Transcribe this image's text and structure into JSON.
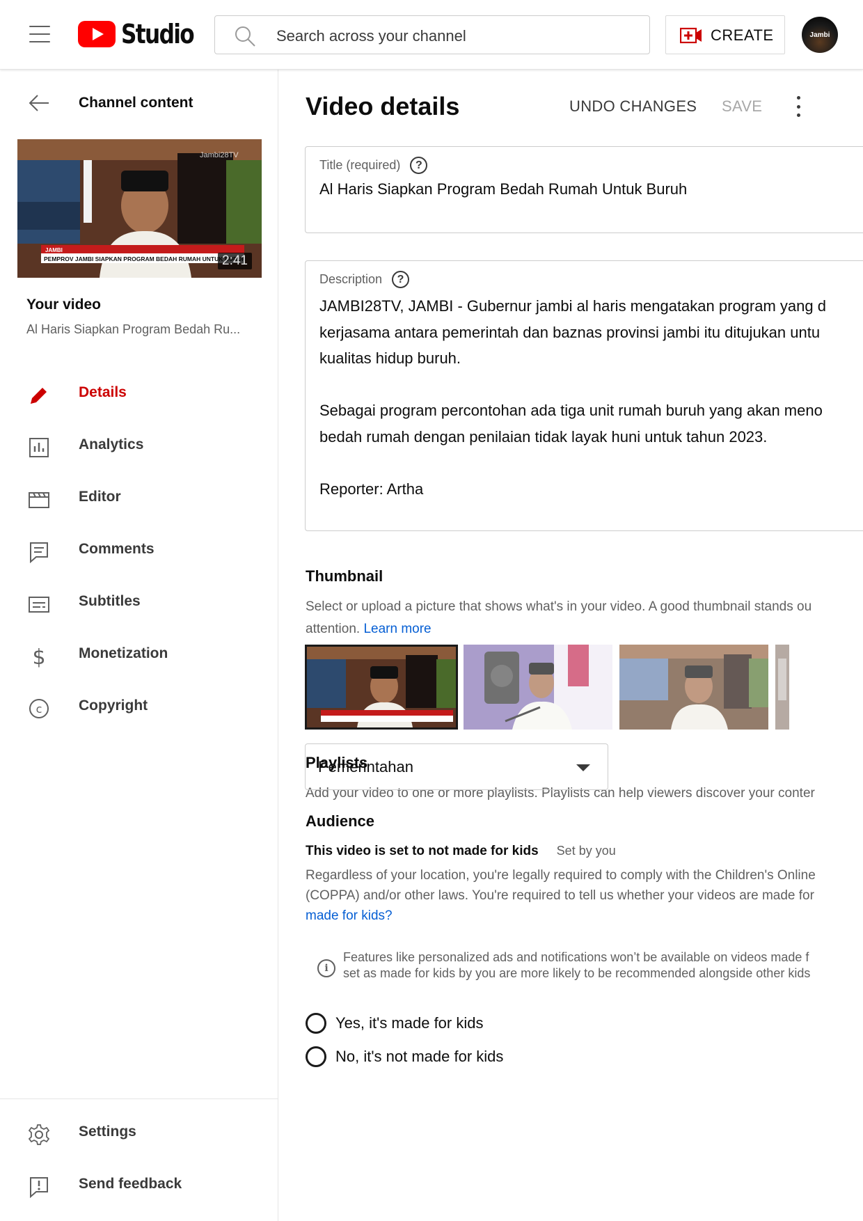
{
  "header": {
    "app_name": "Studio",
    "search_placeholder": "Search across your channel",
    "create_label": "CREATE",
    "avatar_text": "Jambi"
  },
  "sidebar": {
    "back_label": "Channel content",
    "thumbnail": {
      "duration": "2:41",
      "banner_small": "JAMBI",
      "banner_text": "PEMPROV JAMBI SIAPKAN PROGRAM BEDAH RUMAH UNTUK BURUH",
      "watermark": "Jambi28TV"
    },
    "your_video_label": "Your video",
    "video_title_truncated": "Al Haris Siapkan Program Bedah Ru...",
    "nav": [
      {
        "label": "Details",
        "icon": "pencil-icon",
        "active": true
      },
      {
        "label": "Analytics",
        "icon": "analytics-icon",
        "active": false
      },
      {
        "label": "Editor",
        "icon": "editor-icon",
        "active": false
      },
      {
        "label": "Comments",
        "icon": "comments-icon",
        "active": false
      },
      {
        "label": "Subtitles",
        "icon": "subtitles-icon",
        "active": false
      },
      {
        "label": "Monetization",
        "icon": "dollar-icon",
        "active": false
      },
      {
        "label": "Copyright",
        "icon": "copyright-icon",
        "active": false
      }
    ],
    "footer": [
      {
        "label": "Settings",
        "icon": "gear-icon"
      },
      {
        "label": "Send feedback",
        "icon": "feedback-icon"
      }
    ]
  },
  "main": {
    "title": "Video details",
    "undo_label": "UNDO CHANGES",
    "save_label": "SAVE",
    "title_field": {
      "label": "Title (required)",
      "value": "Al Haris Siapkan Program Bedah Rumah Untuk Buruh"
    },
    "description_field": {
      "label": "Description",
      "lines": [
        "JAMBI28TV, JAMBI - Gubernur jambi al haris mengatakan program yang d",
        "kerjasama antara pemerintah dan baznas provinsi jambi itu ditujukan untu",
        "kualitas hidup buruh.",
        "",
        "Sebagai program percontohan ada tiga unit rumah buruh yang akan meno",
        "bedah rumah dengan penilaian tidak layak huni untuk tahun 2023.",
        "",
        "Reporter: Artha"
      ]
    },
    "thumbnail_section": {
      "heading": "Thumbnail",
      "text": "Select or upload a picture that shows what's in your video. A good thumbnail stands ou",
      "text2": "attention.",
      "link": "Learn more"
    },
    "playlists_section": {
      "heading": "Playlists",
      "text": "Add your video to one or more playlists. Playlists can help viewers discover your conter",
      "selected": "Pemerintahan"
    },
    "audience_section": {
      "heading": "Audience",
      "status": "This video is set to not made for kids",
      "set_by": "Set by you",
      "text_line1": "Regardless of your location, you're legally required to comply with the Children's Online",
      "text_line2": "(COPPA) and/or other laws. You're required to tell us whether your videos are made for",
      "link": "made for kids?",
      "info_line1": "Features like personalized ads and notifications won’t be available on videos made f",
      "info_line2": "set as made for kids by you are more likely to be recommended alongside other kids",
      "option_yes": "Yes, it's made for kids",
      "option_no": "No, it's not made for kids"
    }
  },
  "colors": {
    "brand_red": "#ff0000",
    "active_red": "#cc0000",
    "link_blue": "#065fd4",
    "muted_text": "#606060"
  }
}
